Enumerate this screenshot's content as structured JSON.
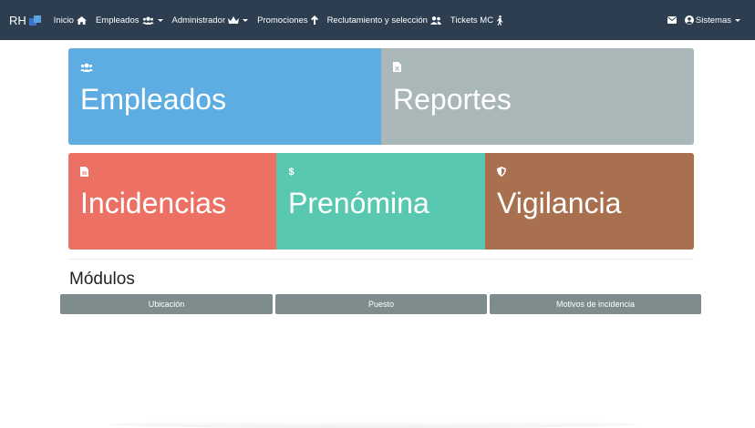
{
  "brand": {
    "text": "RH"
  },
  "nav": {
    "items": [
      {
        "label": "Inicio",
        "icon": "home-icon"
      },
      {
        "label": "Empleados",
        "icon": "users-icon",
        "dropdown": true
      },
      {
        "label": "Administrador",
        "icon": "crown-icon",
        "dropdown": true
      },
      {
        "label": "Promociones",
        "icon": "arrow-up-icon"
      },
      {
        "label": "Reclutamiento y selección",
        "icon": "user-friends-icon"
      },
      {
        "label": "Tickets MC",
        "icon": "walking-icon"
      }
    ],
    "right": {
      "mail_icon": "envelope-icon",
      "user_label": "Sistemas",
      "user_icon": "user-circle-icon"
    }
  },
  "tiles": {
    "empleados": {
      "label": "Empleados",
      "icon": "users-icon",
      "color": "#5dade2"
    },
    "reportes": {
      "label": "Reportes",
      "icon": "file-excel-icon",
      "color": "#aab7b8"
    },
    "incidencias": {
      "label": "Incidencias",
      "icon": "file-icon",
      "color": "#ec7063"
    },
    "prenomina": {
      "label": "Prenómina",
      "icon": "dollar-icon",
      "color": "#58c9b0"
    },
    "vigilancia": {
      "label": "Vigilancia",
      "icon": "shield-icon",
      "color": "#a9704f"
    }
  },
  "modules": {
    "title": "Módulos",
    "buttons": [
      {
        "label": "Ubicación"
      },
      {
        "label": "Puesto"
      },
      {
        "label": "Motivos de incidencia"
      }
    ],
    "button_color": "#7f8c8d"
  },
  "colors": {
    "navbar": "#2c3e50"
  }
}
